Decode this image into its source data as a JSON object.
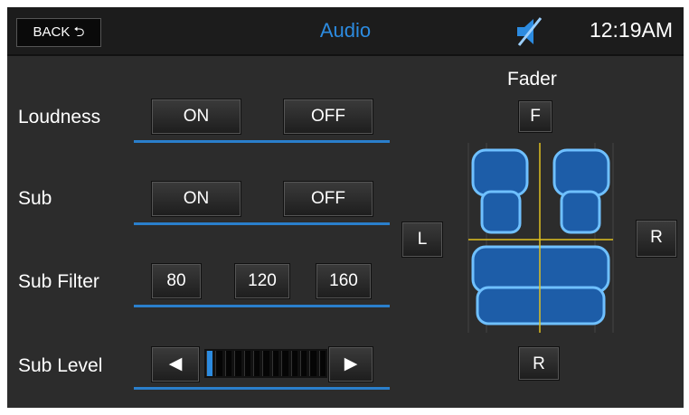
{
  "header": {
    "back_label": "BACK ⮌",
    "title": "Audio",
    "time": "12:19AM",
    "mute_icon": "speaker-muted-icon"
  },
  "loudness": {
    "label": "Loudness",
    "on": "ON",
    "off": "OFF"
  },
  "sub": {
    "label": "Sub",
    "on": "ON",
    "off": "OFF"
  },
  "sub_filter": {
    "label": "Sub Filter",
    "options": [
      "80",
      "120",
      "160"
    ]
  },
  "sub_level": {
    "label": "Sub Level",
    "left": "◀",
    "right": "▶",
    "segments": 13,
    "level": 1
  },
  "fader": {
    "label": "Fader",
    "front": "F",
    "left": "L",
    "right": "R",
    "rear": "R"
  },
  "colors": {
    "accent": "#2c8be0",
    "crosshair": "#e0c020"
  }
}
